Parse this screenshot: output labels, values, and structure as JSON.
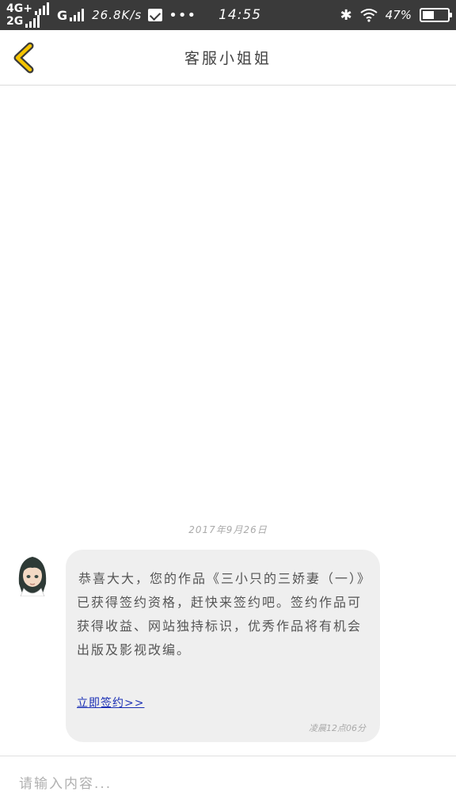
{
  "status_bar": {
    "net1": "4G+",
    "net2": "2G",
    "g_label": "G",
    "speed": "26.8K/s",
    "dots": "•••",
    "time": "14:55",
    "bluetooth": "✱",
    "battery_pct": "47%",
    "battery_level": 0.47
  },
  "header": {
    "title": "客服小姐姐",
    "back_icon": "chevron-left-icon",
    "accent_color": "#f5c400"
  },
  "chat": {
    "timestamp": "2017年9月26日",
    "message": {
      "text": "恭喜大大，您的作品《三小只的三娇妻（一）》已获得签约资格，赶快来签约吧。签约作品可获得收益、网站独持标识，优秀作品将有机会出版及影视改编。",
      "link": "立即签约>>",
      "read_time": "凌晨12点06分"
    }
  },
  "input": {
    "placeholder": "请输入内容..."
  }
}
